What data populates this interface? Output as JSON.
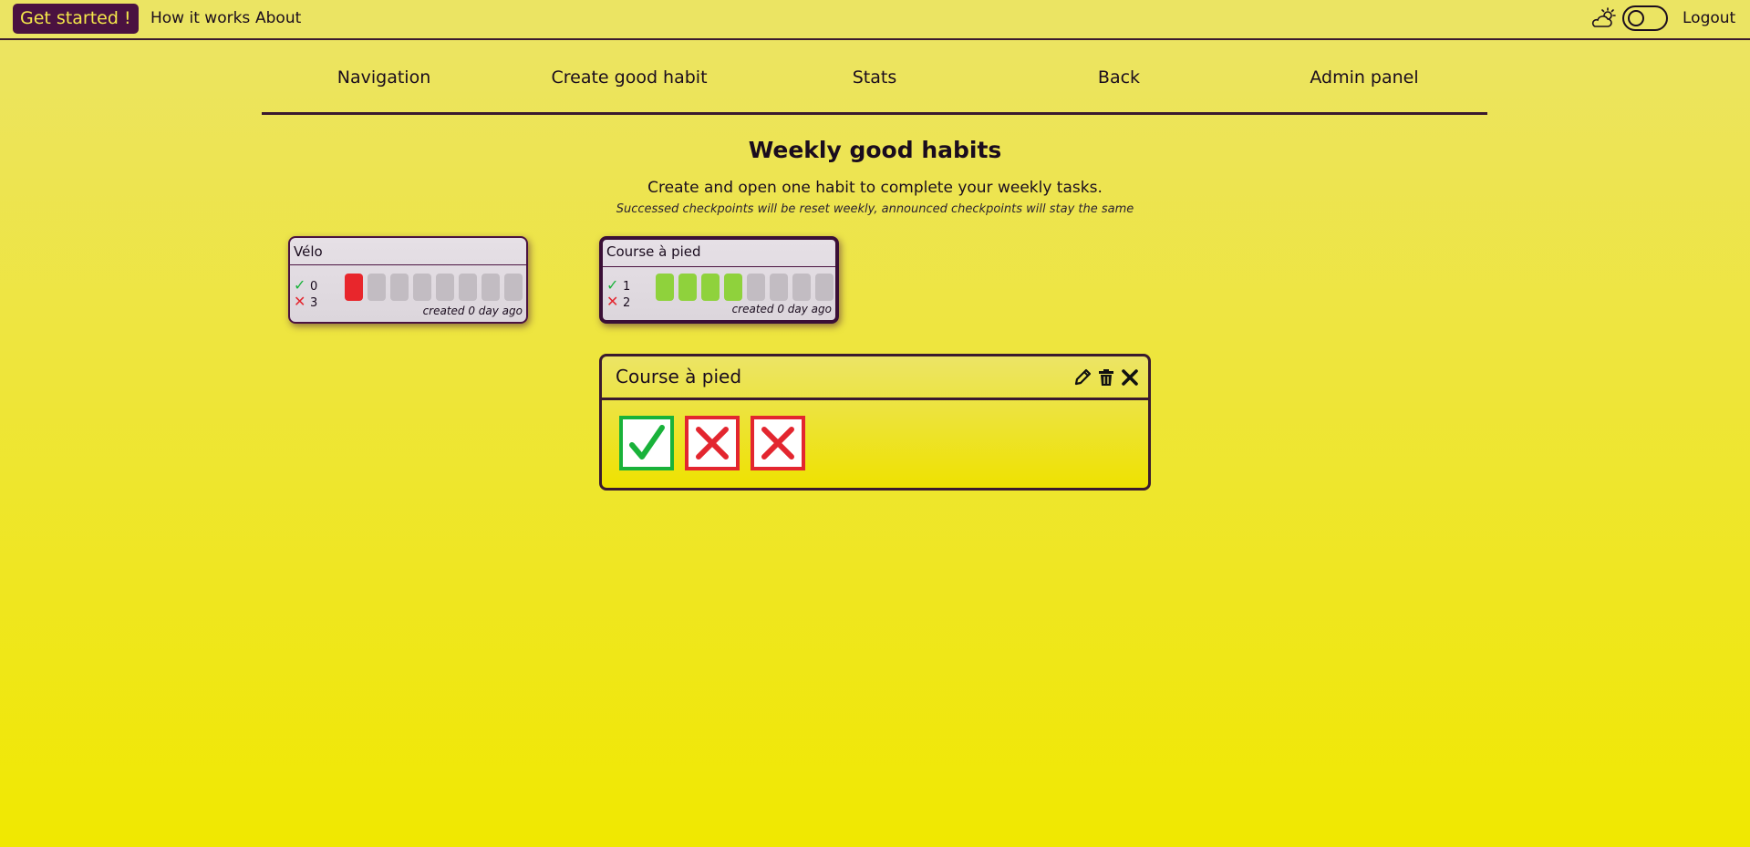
{
  "header": {
    "get_started": "Get started !",
    "how_it_works": "How it works",
    "about": "About",
    "logout": "Logout",
    "weather_icon": "cloud-sun-icon",
    "theme_toggle_icon": "toggle-switch-off"
  },
  "nav": {
    "items": [
      "Navigation",
      "Create good habit",
      "Stats",
      "Back",
      "Admin panel"
    ]
  },
  "page": {
    "title": "Weekly good habits",
    "description": "Create and open one habit to complete your weekly tasks.",
    "note": "Successed checkpoints will be reset weekly, announced checkpoints will stay the same"
  },
  "habits": [
    {
      "name": "Vélo",
      "success_count": "0",
      "fail_count": "3",
      "checkpoints": [
        "ko",
        "empty",
        "empty",
        "empty",
        "empty",
        "empty",
        "empty",
        "empty"
      ],
      "created": "created 0 day ago",
      "selected": false
    },
    {
      "name": "Course à pied",
      "success_count": "1",
      "fail_count": "2",
      "checkpoints": [
        "ok",
        "ok",
        "ok",
        "ok",
        "empty",
        "empty",
        "empty",
        "empty"
      ],
      "created": "created 0 day ago",
      "selected": true
    }
  ],
  "panel": {
    "title": "Course à pied",
    "icons": [
      "pencil-icon",
      "trash-icon",
      "close-icon"
    ],
    "checkboxes": [
      "checked",
      "failed",
      "failed"
    ]
  },
  "colors": {
    "success": "#19b23a",
    "fail": "#e3262f",
    "checkpoint_ok": "#8fd23c",
    "checkpoint_empty": "#c2bcc2",
    "brand": "#4a1240"
  }
}
